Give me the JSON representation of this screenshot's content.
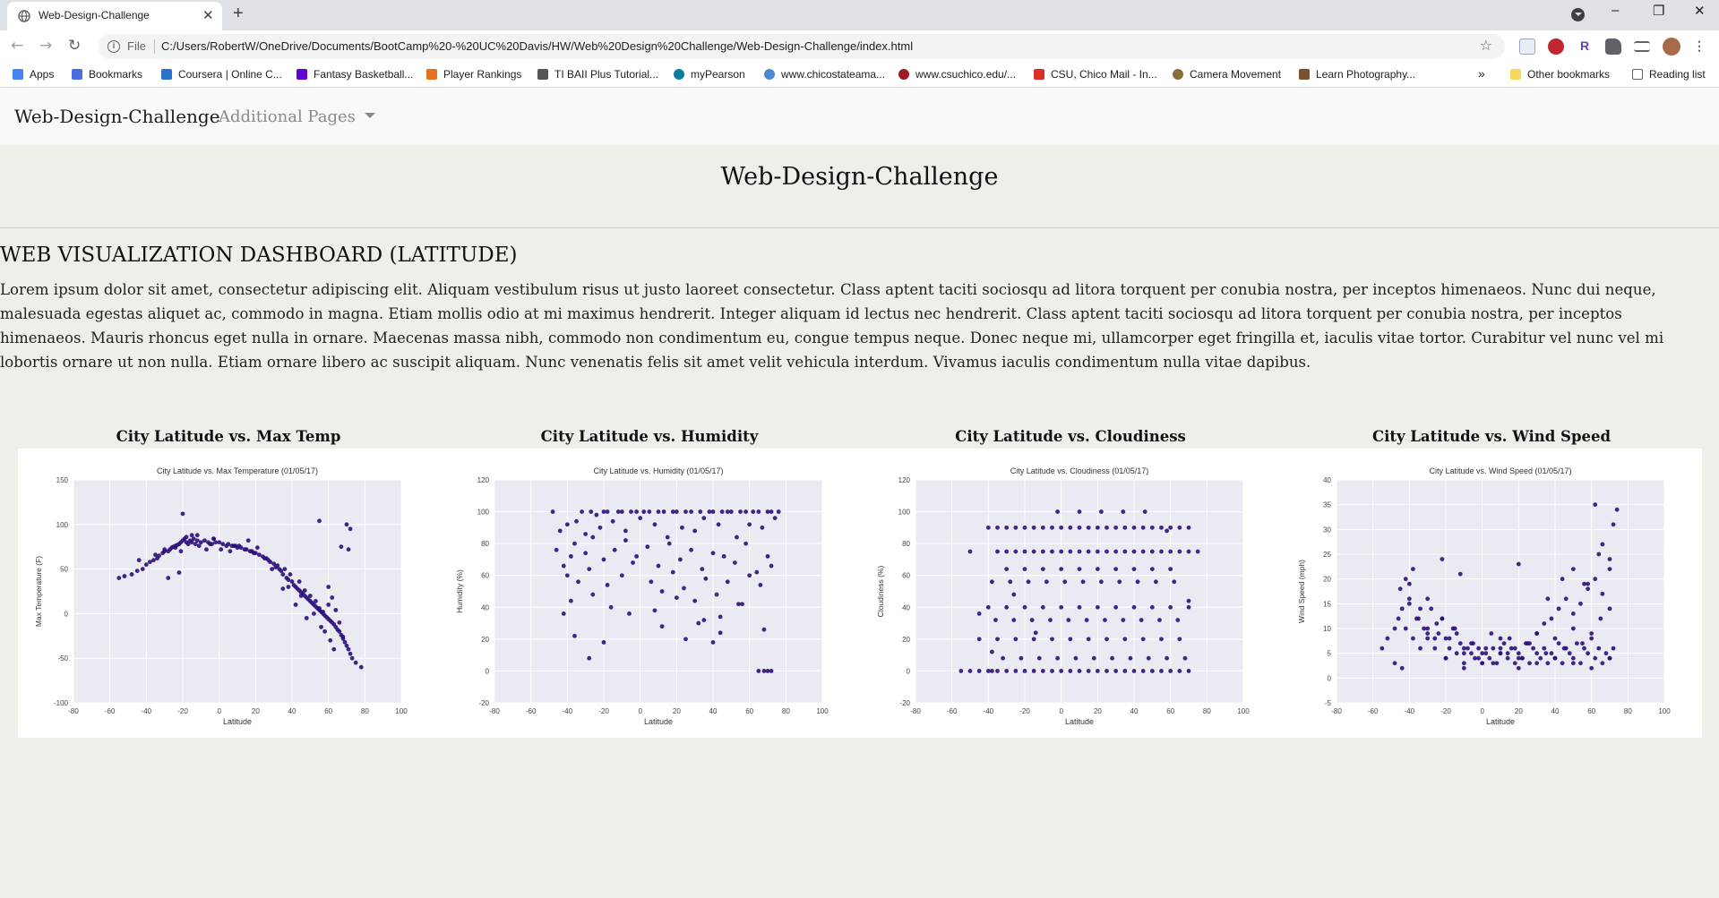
{
  "browser": {
    "tab_title": "Web-Design-Challenge",
    "tab_close": "✕",
    "new_tab": "+",
    "window_controls": [
      "–",
      "❐",
      "✕"
    ],
    "nav": [
      "←",
      "→",
      "↻"
    ],
    "address_scheme": "File",
    "address_url": "C:/Users/RobertW/OneDrive/Documents/BootCamp%20-%20UC%20Davis/HW/Web%20Design%20Challenge/Web-Design-Challenge/index.html",
    "star_icon": "☆",
    "bookmarks": [
      {
        "label": "Apps",
        "icon": "apps-icon",
        "color": "#4285f4"
      },
      {
        "label": "Bookmarks",
        "icon": "star-icon",
        "color": "#4a6ee0"
      },
      {
        "label": "Coursera | Online C...",
        "icon": "coursera-icon",
        "color": "#2a73cc"
      },
      {
        "label": "Fantasy Basketball...",
        "icon": "yahoo-icon",
        "color": "#6001d2"
      },
      {
        "label": "Player Rankings",
        "icon": "rankings-icon",
        "color": "#e8711a"
      },
      {
        "label": "TI BAII Plus Tutorial...",
        "icon": "ti-icon",
        "color": "#555555"
      },
      {
        "label": "myPearson",
        "icon": "pearson-icon",
        "color": "#0b7e9f"
      },
      {
        "label": "www.chicostateama...",
        "icon": "chico-icon",
        "color": "#4b8ad1"
      },
      {
        "label": "www.csuchico.edu/...",
        "icon": "csuchico-icon",
        "color": "#9d1d20"
      },
      {
        "label": "CSU, Chico Mail - In...",
        "icon": "gmail-icon",
        "color": "#d93025"
      },
      {
        "label": "Camera Movement",
        "icon": "camera-icon",
        "color": "#8a6d3b"
      },
      {
        "label": "Learn Photography...",
        "icon": "photo-icon",
        "color": "#7a5230"
      }
    ],
    "bookmarks_more": "»",
    "other_bookmarks": "Other bookmarks",
    "reading_list": "Reading list"
  },
  "navbar": {
    "brand": "Web-Design-Challenge",
    "dropdown": "Additional Pages"
  },
  "page": {
    "title": "Web-Design-Challenge",
    "section_title": "WEB VISUALIZATION DASHBOARD (LATITUDE)",
    "paragraph": "Lorem ipsum dolor sit amet, consectetur adipiscing elit. Aliquam vestibulum risus ut justo laoreet consectetur. Class aptent taciti sociosqu ad litora torquent per conubia nostra, per inceptos himenaeos. Nunc dui neque, malesuada egestas aliquet ac, commodo in magna. Etiam mollis odio at mi maximus hendrerit. Integer aliquam id lectus nec hendrerit. Class aptent taciti sociosqu ad litora torquent per conubia nostra, per inceptos himenaeos. Mauris rhoncus eget nulla in ornare. Maecenas massa nibh, commodo non condimentum eu, congue tempus neque. Donec neque mi, ullamcorper eget fringilla et, iaculis vitae tortor. Curabitur vel nunc vel mi lobortis ornare ut non nulla. Etiam ornare libero ac suscipit aliquam. Nunc venenatis felis sit amet velit vehicula interdum. Vivamus iaculis condimentum nulla vitae dapibus."
  },
  "cards": [
    {
      "heading": "City Latitude vs. Max Temp"
    },
    {
      "heading": "City Latitude vs. Humidity"
    },
    {
      "heading": "City Latitude vs. Cloudiness"
    },
    {
      "heading": "City Latitude vs. Wind Speed"
    }
  ],
  "colors": {
    "point": "#2b0f7a",
    "plot_bg": "#eaeaf2"
  },
  "chart_data": [
    {
      "type": "scatter",
      "title": "City Latitude vs. Max Temperature (01/05/17)",
      "xlabel": "Latitude",
      "ylabel": "Max Temperature (F)",
      "xlim": [
        -80,
        100
      ],
      "ylim": [
        -100,
        150
      ],
      "xticks": [
        -80,
        -60,
        -40,
        -20,
        0,
        20,
        40,
        60,
        80,
        100
      ],
      "yticks": [
        -100,
        -50,
        0,
        50,
        100,
        150
      ],
      "x": [
        -55,
        -52,
        -48,
        -45,
        -42,
        -40,
        -38,
        -36,
        -34,
        -33,
        -31,
        -30,
        -28,
        -27,
        -26,
        -25,
        -24,
        -23,
        -22,
        -21,
        -20,
        -19,
        -18,
        -17,
        -16,
        -15,
        -14,
        -13,
        -12,
        -10,
        -8,
        -6,
        -5,
        -4,
        -2,
        0,
        2,
        4,
        5,
        7,
        9,
        10,
        12,
        14,
        15,
        17,
        19,
        20,
        22,
        24,
        25,
        27,
        28,
        30,
        31,
        33,
        34,
        35,
        37,
        38,
        40,
        41,
        42,
        43,
        44,
        45,
        46,
        47,
        48,
        49,
        50,
        51,
        52,
        53,
        54,
        55,
        56,
        57,
        58,
        59,
        60,
        61,
        62,
        63,
        64,
        65,
        66,
        67,
        68,
        69,
        70,
        71,
        72,
        73,
        75,
        78,
        -44,
        -35,
        -30,
        -24,
        -21,
        -18,
        -15,
        -11,
        -7,
        -3,
        1,
        6,
        11,
        16,
        21,
        26,
        32,
        36,
        39,
        44,
        47,
        50,
        53,
        55,
        57,
        60,
        62,
        64,
        66,
        68,
        70,
        72,
        -20,
        -12,
        -3,
        8,
        18,
        29,
        38,
        45,
        52,
        58,
        63,
        67,
        71,
        55,
        60,
        -22,
        -28,
        35,
        42,
        48,
        56,
        61,
        66,
        69
      ],
      "y": [
        40,
        42,
        44,
        48,
        50,
        55,
        58,
        60,
        62,
        65,
        68,
        70,
        70,
        72,
        74,
        75,
        76,
        77,
        78,
        80,
        82,
        84,
        80,
        78,
        82,
        80,
        84,
        78,
        82,
        80,
        82,
        80,
        78,
        78,
        80,
        80,
        78,
        76,
        78,
        76,
        76,
        74,
        74,
        72,
        72,
        70,
        68,
        68,
        66,
        64,
        62,
        60,
        58,
        56,
        52,
        50,
        48,
        44,
        40,
        38,
        36,
        32,
        30,
        28,
        26,
        24,
        22,
        20,
        18,
        16,
        14,
        12,
        10,
        8,
        6,
        4,
        2,
        0,
        -2,
        -4,
        -6,
        -8,
        -10,
        -12,
        -15,
        -18,
        -20,
        -24,
        -28,
        -32,
        -36,
        -40,
        -45,
        -50,
        -55,
        -60,
        60,
        66,
        72,
        74,
        70,
        86,
        88,
        76,
        72,
        84,
        72,
        70,
        76,
        82,
        74,
        62,
        54,
        50,
        44,
        36,
        26,
        20,
        14,
        6,
        2,
        10,
        18,
        4,
        -10,
        -26,
        100,
        95,
        112,
        88,
        84,
        76,
        70,
        50,
        30,
        20,
        0,
        -20,
        -40,
        75,
        72,
        104,
        30,
        46,
        40,
        28,
        10,
        -5,
        -15,
        -30
      ]
    },
    {
      "type": "scatter",
      "title": "City Latitude vs. Humidity (01/05/17)",
      "xlabel": "Latitude",
      "ylabel": "Humidity (%)",
      "xlim": [
        -80,
        100
      ],
      "ylim": [
        -20,
        120
      ],
      "xticks": [
        -80,
        -60,
        -40,
        -20,
        0,
        20,
        40,
        60,
        80,
        100
      ],
      "yticks": [
        -20,
        0,
        20,
        40,
        60,
        80,
        100,
        120
      ],
      "x": [
        -48,
        -44,
        -40,
        -38,
        -35,
        -32,
        -30,
        -27,
        -24,
        -22,
        -20,
        -18,
        -15,
        -12,
        -10,
        -8,
        -5,
        -2,
        0,
        2,
        5,
        8,
        10,
        13,
        15,
        18,
        20,
        23,
        25,
        28,
        30,
        33,
        35,
        38,
        40,
        43,
        45,
        48,
        50,
        53,
        55,
        58,
        60,
        62,
        65,
        67,
        70,
        72,
        74,
        76,
        -46,
        -42,
        -36,
        -30,
        -26,
        -20,
        -14,
        -8,
        -2,
        4,
        10,
        16,
        22,
        28,
        34,
        40,
        46,
        52,
        58,
        64,
        70,
        -40,
        -34,
        -28,
        -18,
        -10,
        -4,
        6,
        12,
        18,
        24,
        30,
        36,
        42,
        48,
        54,
        60,
        66,
        72,
        -38,
        -26,
        -16,
        -6,
        8,
        20,
        32,
        44,
        56,
        68,
        -20,
        -28,
        -36,
        -42,
        12,
        25,
        35,
        40,
        44,
        65,
        68,
        70,
        72
      ],
      "y": [
        100,
        88,
        92,
        72,
        94,
        100,
        86,
        100,
        98,
        90,
        100,
        100,
        94,
        100,
        100,
        88,
        100,
        100,
        96,
        100,
        100,
        92,
        100,
        100,
        84,
        100,
        100,
        90,
        100,
        100,
        88,
        100,
        96,
        100,
        100,
        92,
        100,
        100,
        100,
        84,
        100,
        100,
        92,
        100,
        100,
        90,
        100,
        100,
        96,
        100,
        76,
        66,
        80,
        74,
        84,
        70,
        76,
        82,
        72,
        78,
        66,
        80,
        70,
        76,
        64,
        74,
        72,
        68,
        80,
        62,
        72,
        60,
        56,
        64,
        54,
        60,
        68,
        56,
        50,
        62,
        52,
        44,
        58,
        48,
        56,
        42,
        60,
        54,
        66,
        44,
        48,
        40,
        36,
        38,
        46,
        30,
        34,
        42,
        26,
        18,
        8,
        22,
        36,
        28,
        20,
        32,
        18,
        24,
        0,
        0,
        0,
        0
      ]
    },
    {
      "type": "scatter",
      "title": "City Latitude vs. Cloudiness (01/05/17)",
      "xlabel": "Latitude",
      "ylabel": "Cloudiness (%)",
      "xlim": [
        -80,
        100
      ],
      "ylim": [
        -20,
        120
      ],
      "xticks": [
        -80,
        -60,
        -40,
        -20,
        0,
        20,
        40,
        60,
        80,
        100
      ],
      "yticks": [
        -20,
        0,
        20,
        40,
        60,
        80,
        100,
        120
      ],
      "x": [
        -55,
        -50,
        -45,
        -40,
        -38,
        -35,
        -30,
        -25,
        -20,
        -15,
        -10,
        -5,
        0,
        5,
        10,
        15,
        20,
        25,
        30,
        35,
        40,
        45,
        50,
        55,
        60,
        65,
        70,
        -40,
        -35,
        -30,
        -25,
        -20,
        -15,
        -10,
        -5,
        0,
        5,
        10,
        15,
        20,
        25,
        30,
        35,
        40,
        45,
        50,
        55,
        60,
        65,
        70,
        -35,
        -30,
        -25,
        -20,
        -15,
        -10,
        -5,
        0,
        5,
        10,
        15,
        20,
        25,
        30,
        35,
        40,
        45,
        50,
        55,
        60,
        65,
        70,
        75,
        -45,
        -35,
        -25,
        -15,
        -5,
        5,
        15,
        25,
        35,
        45,
        55,
        65,
        -40,
        -30,
        -20,
        -10,
        0,
        10,
        20,
        30,
        40,
        50,
        60,
        70,
        -38,
        -28,
        -18,
        -8,
        2,
        12,
        22,
        32,
        42,
        52,
        62,
        -32,
        -22,
        -12,
        -2,
        8,
        18,
        28,
        38,
        48,
        58,
        68,
        -36,
        -26,
        -16,
        -6,
        4,
        14,
        24,
        34,
        44,
        54,
        64,
        -30,
        -20,
        -10,
        0,
        10,
        20,
        30,
        40,
        50,
        60,
        -50,
        -45,
        -38,
        -26,
        -14,
        -2,
        10,
        22,
        34,
        46,
        58,
        70
      ],
      "y": [
        0,
        0,
        0,
        0,
        0,
        0,
        0,
        0,
        0,
        0,
        0,
        0,
        0,
        0,
        0,
        0,
        0,
        0,
        0,
        0,
        0,
        0,
        0,
        0,
        0,
        0,
        0,
        90,
        90,
        90,
        90,
        90,
        90,
        90,
        90,
        90,
        90,
        90,
        90,
        90,
        90,
        90,
        90,
        90,
        90,
        90,
        90,
        90,
        90,
        90,
        75,
        75,
        75,
        75,
        75,
        75,
        75,
        75,
        75,
        75,
        75,
        75,
        75,
        75,
        75,
        75,
        75,
        75,
        75,
        75,
        75,
        75,
        75,
        20,
        20,
        20,
        20,
        20,
        20,
        20,
        20,
        20,
        20,
        20,
        20,
        40,
        40,
        40,
        40,
        40,
        40,
        40,
        40,
        40,
        40,
        40,
        40,
        56,
        56,
        56,
        56,
        56,
        56,
        56,
        56,
        56,
        56,
        56,
        8,
        8,
        8,
        8,
        8,
        8,
        8,
        8,
        8,
        8,
        8,
        32,
        32,
        32,
        32,
        32,
        32,
        32,
        32,
        32,
        32,
        32,
        64,
        64,
        64,
        64,
        64,
        64,
        64,
        64,
        64,
        64,
        75,
        36,
        12,
        48,
        24,
        100,
        100,
        100,
        100,
        100,
        88,
        44
      ]
    },
    {
      "type": "scatter",
      "title": "City Latitude vs. Wind Speed (01/05/17)",
      "xlabel": "Latitude",
      "ylabel": "Wind Speed (mph)",
      "xlim": [
        -80,
        100
      ],
      "ylim": [
        -5,
        40
      ],
      "xticks": [
        -80,
        -60,
        -40,
        -20,
        0,
        20,
        40,
        60,
        80,
        100
      ],
      "yticks": [
        -5,
        0,
        5,
        10,
        15,
        20,
        25,
        30,
        35,
        40
      ],
      "x": [
        -55,
        -52,
        -48,
        -46,
        -44,
        -42,
        -40,
        -38,
        -36,
        -34,
        -32,
        -30,
        -28,
        -26,
        -24,
        -22,
        -20,
        -18,
        -16,
        -14,
        -12,
        -10,
        -8,
        -6,
        -4,
        -2,
        0,
        2,
        4,
        6,
        8,
        10,
        12,
        14,
        16,
        18,
        20,
        22,
        24,
        26,
        28,
        30,
        32,
        34,
        36,
        38,
        40,
        42,
        44,
        46,
        48,
        50,
        52,
        54,
        56,
        58,
        60,
        62,
        64,
        66,
        68,
        70,
        72,
        -45,
        -40,
        -35,
        -30,
        -25,
        -20,
        -15,
        -10,
        -5,
        0,
        5,
        10,
        15,
        20,
        25,
        30,
        35,
        40,
        45,
        50,
        55,
        60,
        65,
        70,
        -42,
        -38,
        -34,
        -30,
        -26,
        -22,
        -18,
        -14,
        -10,
        -6,
        -2,
        2,
        6,
        10,
        14,
        18,
        22,
        26,
        30,
        34,
        38,
        42,
        46,
        50,
        54,
        58,
        62,
        66,
        70,
        -40,
        -30,
        -20,
        -10,
        0,
        10,
        20,
        30,
        40,
        50,
        60,
        70,
        -48,
        -44,
        -22,
        -12,
        20,
        36,
        44,
        50,
        56,
        62,
        66,
        70,
        72,
        74,
        64,
        58
      ],
      "y": [
        6,
        8,
        10,
        12,
        14,
        10,
        16,
        8,
        12,
        6,
        10,
        8,
        14,
        6,
        9,
        12,
        4,
        8,
        10,
        5,
        7,
        3,
        6,
        5,
        4,
        6,
        3,
        5,
        4,
        6,
        3,
        5,
        7,
        4,
        6,
        3,
        5,
        4,
        7,
        3,
        6,
        5,
        4,
        6,
        3,
        5,
        4,
        7,
        3,
        6,
        5,
        4,
        7,
        3,
        6,
        5,
        8,
        4,
        6,
        3,
        5,
        4,
        6,
        18,
        15,
        12,
        9,
        11,
        8,
        10,
        6,
        7,
        5,
        9,
        6,
        8,
        4,
        7,
        9,
        5,
        8,
        6,
        10,
        7,
        9,
        12,
        14,
        20,
        22,
        14,
        10,
        8,
        12,
        6,
        9,
        5,
        7,
        4,
        6,
        3,
        8,
        5,
        6,
        4,
        7,
        9,
        11,
        12,
        14,
        16,
        13,
        15,
        18,
        20,
        17,
        22,
        19,
        16,
        4,
        2,
        3,
        5,
        2,
        3,
        4,
        3,
        2,
        4,
        3,
        2,
        24,
        21,
        23,
        16,
        20,
        22,
        19,
        35,
        27,
        24,
        31,
        34,
        25,
        19,
        28,
        25
      ]
    }
  ]
}
